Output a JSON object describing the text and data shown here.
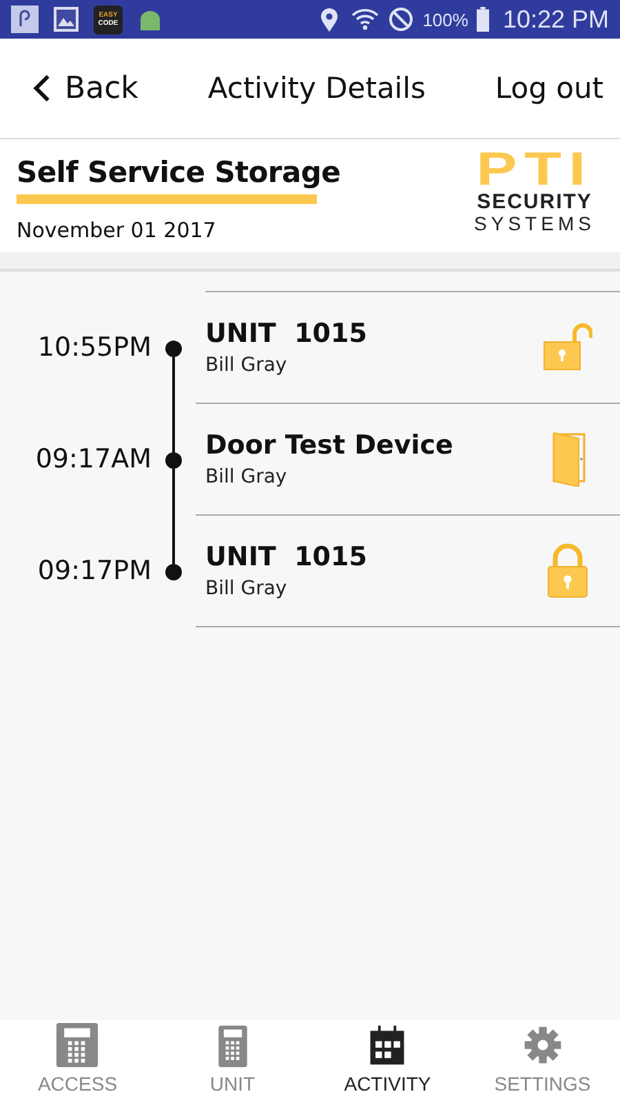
{
  "status_bar": {
    "app_icon_text": [
      "EASY",
      "CODE"
    ],
    "battery": "100%",
    "time": "10:22 PM"
  },
  "header": {
    "back": "Back",
    "title": "Activity Details",
    "logout": "Log out"
  },
  "site": {
    "name": "Self Service Storage",
    "date": "November 01 2017",
    "logo": {
      "mark": "PTI",
      "line1": "SECURITY",
      "line2": "SYSTEMS"
    }
  },
  "events": [
    {
      "time": "10:55PM",
      "title": "UNIT  1015",
      "user": "Bill Gray",
      "kind": "unlocked"
    },
    {
      "time": "09:17AM",
      "title": "Door Test Device",
      "user": "Bill Gray",
      "kind": "door"
    },
    {
      "time": "09:17PM",
      "title": "UNIT  1015",
      "user": "Bill Gray",
      "kind": "locked"
    }
  ],
  "nav": [
    {
      "label": "ACCESS",
      "kind": "keypad",
      "selected": false
    },
    {
      "label": "UNIT",
      "kind": "keypad-small",
      "selected": false
    },
    {
      "label": "ACTIVITY",
      "kind": "calendar",
      "selected": true
    },
    {
      "label": "SETTINGS",
      "kind": "gear",
      "selected": false
    }
  ]
}
